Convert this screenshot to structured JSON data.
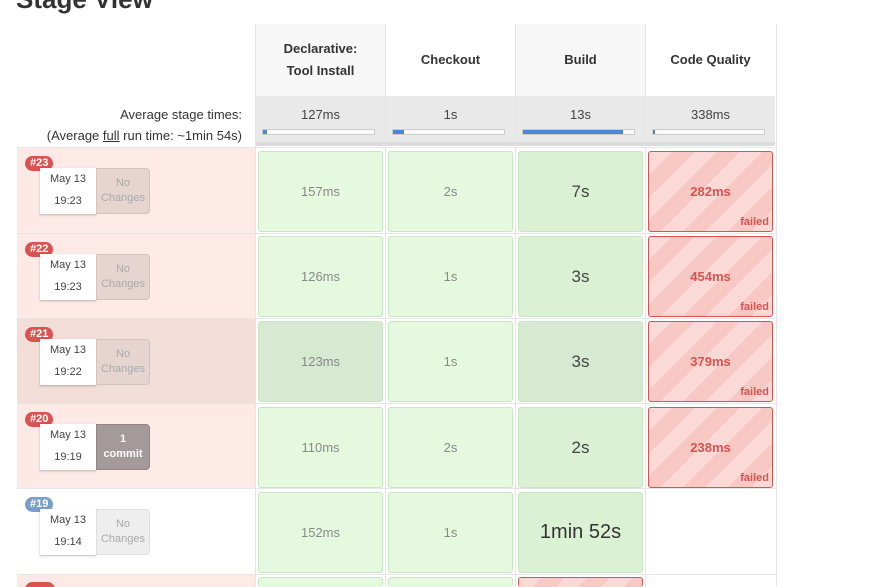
{
  "page_title": "Stage View",
  "stages": [
    {
      "name_line1": "Declarative:",
      "name_line2": "Tool Install",
      "avg": "127ms",
      "avg_fraction": 0.04
    },
    {
      "name_line1": "Checkout",
      "name_line2": "",
      "avg": "1s",
      "avg_fraction": 0.1
    },
    {
      "name_line1": "Build",
      "name_line2": "",
      "avg": "13s",
      "avg_fraction": 0.9
    },
    {
      "name_line1": "Code Quality",
      "name_line2": "",
      "avg": "338ms",
      "avg_fraction": 0.02
    }
  ],
  "average_stage_times_label": "Average stage times:",
  "average_run_prefix": "(Average ",
  "average_run_link": "full",
  "average_run_suffix": " run time: ~1min 54s)",
  "builds": [
    {
      "number": "#23",
      "date": "May 13",
      "time": "19:23",
      "changes_line1": "No",
      "changes_line2": "Changes",
      "stages": [
        "157ms",
        "2s",
        "7s",
        "282ms"
      ],
      "status": "failed",
      "failed_label": "failed"
    },
    {
      "number": "#22",
      "date": "May 13",
      "time": "19:23",
      "changes_line1": "No",
      "changes_line2": "Changes",
      "stages": [
        "126ms",
        "1s",
        "3s",
        "454ms"
      ],
      "status": "failed",
      "failed_label": "failed"
    },
    {
      "number": "#21",
      "date": "May 13",
      "time": "19:22",
      "changes_line1": "No",
      "changes_line2": "Changes",
      "stages": [
        "123ms",
        "1s",
        "3s",
        "379ms"
      ],
      "status": "failed",
      "failed_label": "failed"
    },
    {
      "number": "#20",
      "date": "May 13",
      "time": "19:19",
      "changes_line1": "1",
      "changes_line2": "commit",
      "stages": [
        "110ms",
        "2s",
        "2s",
        "238ms"
      ],
      "status": "failed",
      "failed_label": "failed"
    },
    {
      "number": "#19",
      "date": "May 13",
      "time": "19:14",
      "changes_line1": "No",
      "changes_line2": "Changes",
      "stages": [
        "152ms",
        "1s",
        "1min 52s",
        ""
      ],
      "status": "success",
      "failed_label": ""
    }
  ],
  "colors": {
    "failed": "#d9534f",
    "success_bg": "#e5f9df",
    "progress": "#4a87d6"
  }
}
